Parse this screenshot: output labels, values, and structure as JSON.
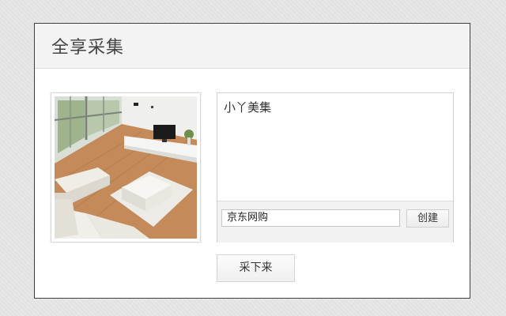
{
  "dialog": {
    "title": "全享采集"
  },
  "image": {
    "icon": "living-room-photo",
    "description_visible": false
  },
  "content": {
    "text": "小丫美集"
  },
  "board": {
    "selected": "京东网购"
  },
  "buttons": {
    "create_label": "创建",
    "collect_label": "采下来"
  }
}
